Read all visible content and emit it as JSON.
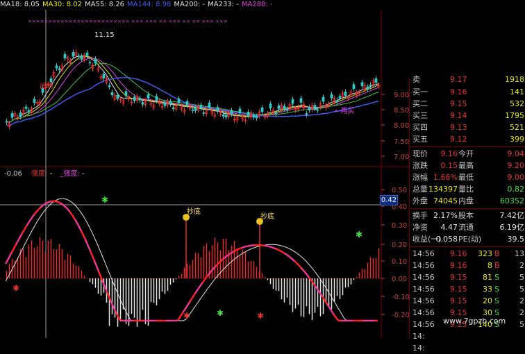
{
  "ma_header": [
    {
      "label": "MA18: 8.05",
      "color": "#e0e0e0"
    },
    {
      "label": "MA30: 8.02",
      "color": "#e8e800"
    },
    {
      "label": "MA55: 8.26",
      "color": "#e0e0e0"
    },
    {
      "label": "MA144: 8.98",
      "color": "#3c5cf0"
    },
    {
      "label": "MA200: -",
      "color": "#e0e0e0"
    },
    {
      "label": "MA233: -",
      "color": "#e0e0e0"
    },
    {
      "label": "MA288: -",
      "color": "#e040e0"
    }
  ],
  "price_axis": [
    "9.00",
    "8.50",
    "8.00",
    "7.50",
    "7.00"
  ],
  "osc_axis": [
    "0.50",
    "0.40",
    "0.30",
    "0.20",
    "0.10",
    "0.00",
    "-0.10",
    "-0.20"
  ],
  "current_value": "0.42",
  "indicator_header": {
    "value": "-0.06",
    "label1": "强度:",
    "label2": "_强度:",
    "tail": "-"
  },
  "annotations": {
    "high_label": "11.15",
    "rebuy_label": "←再买",
    "bottom1": "抄底",
    "bottom2": "抄底",
    "small_label": "出场"
  },
  "quote_panel": {
    "top_partial": {
      "label": "卖",
      "price": "9.17",
      "vol": "1918"
    },
    "bids": [
      {
        "label": "买一",
        "price": "9.16",
        "vol": "141"
      },
      {
        "label": "买二",
        "price": "9.15",
        "vol": "532"
      },
      {
        "label": "买三",
        "price": "9.14",
        "vol": "1795"
      },
      {
        "label": "买四",
        "price": "9.13",
        "vol": "521"
      },
      {
        "label": "买五",
        "price": "9.12",
        "vol": "399"
      }
    ],
    "stats": [
      {
        "l1": "现价",
        "v1": "9.16",
        "l2": "今开",
        "v2": "9.04"
      },
      {
        "l1": "涨跌",
        "v1": "0.15",
        "l2": "最高",
        "v2": "9.20"
      },
      {
        "l1": "涨幅",
        "v1": "1.66%",
        "l2": "最低",
        "v2": "9.00"
      },
      {
        "l1": "总量",
        "v1": "134397",
        "l2": "量比",
        "v2": "0.82"
      },
      {
        "l1": "外盘",
        "v1": "74045",
        "l2": "内盘",
        "v2": "60352"
      }
    ],
    "fund": [
      {
        "l1": "换手",
        "v1": "2.17%",
        "l2": "股本",
        "v2": "7.42亿"
      },
      {
        "l1": "净资",
        "v1": "4.47",
        "l2": "流通",
        "v2": "6.19亿"
      },
      {
        "l1": "收益(一)",
        "v1": "0.058",
        "l2": "PE(动)",
        "v2": "39.5"
      }
    ],
    "ticks": [
      {
        "time": "14:56",
        "price": "9.16",
        "vol": "323",
        "dir": "B",
        "n": "13"
      },
      {
        "time": "14:56",
        "price": "9.16",
        "vol": "8",
        "dir": "B",
        "n": "2"
      },
      {
        "time": "14:56",
        "price": "9.15",
        "vol": "81",
        "dir": "S",
        "n": "5"
      },
      {
        "time": "14:56",
        "price": "9.15",
        "vol": "33",
        "dir": "S",
        "n": "5"
      },
      {
        "time": "14:56",
        "price": "9.15",
        "vol": "20",
        "dir": "S",
        "n": "2"
      },
      {
        "time": "14:56",
        "price": "9.15",
        "vol": "30",
        "dir": "S",
        "n": "2"
      },
      {
        "time": "14:56",
        "price": "9.15",
        "vol": "140",
        "dir": "S",
        "n": "5"
      },
      {
        "time": "14:",
        "price": "",
        "vol": "",
        "dir": "",
        "n": ""
      },
      {
        "time": "14:",
        "price": "",
        "vol": "",
        "dir": "",
        "n": ""
      }
    ]
  },
  "watermark": "www.7gpzb.com",
  "colors": {
    "up": "#e83030",
    "down": "#30c8c8",
    "grid": "#7a0000",
    "strength": "#e8e8e8",
    "strength2": "#e040e0",
    "bright": "#ff2020"
  }
}
